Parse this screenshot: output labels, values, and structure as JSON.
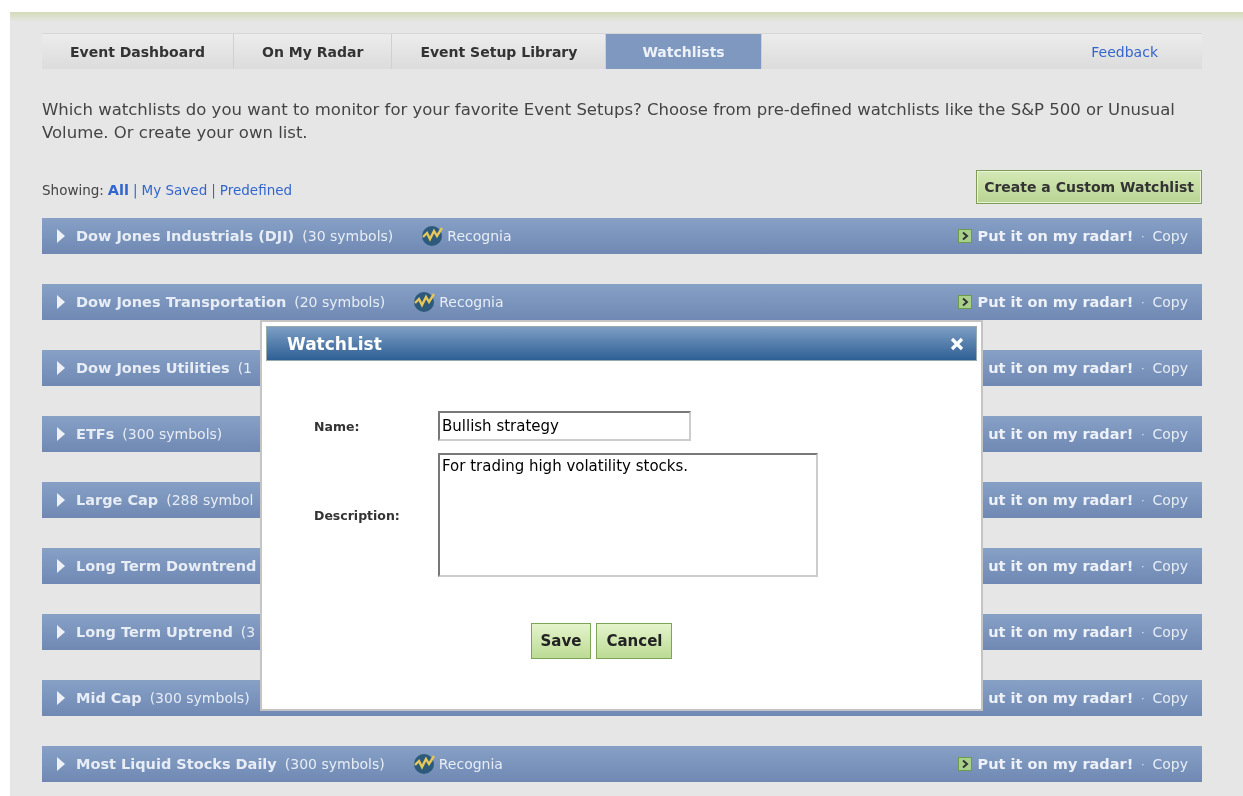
{
  "tabs": [
    {
      "label": "Event Dashboard",
      "selected": false
    },
    {
      "label": "On My Radar",
      "selected": false
    },
    {
      "label": "Event Setup Library",
      "selected": false
    },
    {
      "label": "Watchlists",
      "selected": true
    }
  ],
  "feedback_link": "Feedback",
  "intro": "Which watchlists do you want to monitor for your favorite Event Setups? Choose from pre-defined watchlists like the S&P 500 or Unusual Volume. Or create your own list.",
  "filter": {
    "label": "Showing:",
    "separator": "|",
    "options": [
      {
        "label": "All",
        "selected": true
      },
      {
        "label": "My Saved",
        "selected": false
      },
      {
        "label": "Predefined",
        "selected": false
      }
    ]
  },
  "create_button": "Create a Custom Watchlist",
  "link_separator": "·",
  "watchlists": [
    {
      "name": "Dow Jones Industrials (DJI)",
      "count": "(30 symbols)",
      "source": "Recognia",
      "radar_icon": true,
      "radar": "Put it on my radar!",
      "copy": "Copy"
    },
    {
      "name": "Dow Jones Transportation",
      "count": "(20 symbols)",
      "source": "Recognia",
      "radar_icon": true,
      "radar": "Put it on my radar!",
      "copy": "Copy"
    },
    {
      "name": "Dow Jones Utilities",
      "count": "(1",
      "radar_icon": false,
      "radar": "ut it on my radar!",
      "copy": "Copy"
    },
    {
      "name": "ETFs",
      "count": "(300 symbols)",
      "radar_icon": false,
      "radar": "ut it on my radar!",
      "copy": "Copy"
    },
    {
      "name": "Large Cap",
      "count": "(288 symbol",
      "radar_icon": false,
      "radar": "ut it on my radar!",
      "copy": "Copy"
    },
    {
      "name": "Long Term Downtrend",
      "radar_icon": false,
      "radar": "ut it on my radar!",
      "copy": "Copy"
    },
    {
      "name": "Long Term Uptrend",
      "count": "(3",
      "radar_icon": false,
      "radar": "ut it on my radar!",
      "copy": "Copy"
    },
    {
      "name": "Mid Cap",
      "count": "(300 symbols)",
      "radar_icon": false,
      "radar": "ut it on my radar!",
      "copy": "Copy"
    },
    {
      "name": "Most Liquid Stocks Daily",
      "count": "(300 symbols)",
      "source": "Recognia",
      "radar_icon": true,
      "radar": "Put it on my radar!",
      "copy": "Copy"
    }
  ],
  "dialog": {
    "title": "WatchList",
    "name_label": "Name:",
    "name_value": "Bullish strategy",
    "description_label": "Description:",
    "description_value": "For trading high volatility stocks.",
    "buttons": [
      "Save",
      "Cancel"
    ]
  }
}
